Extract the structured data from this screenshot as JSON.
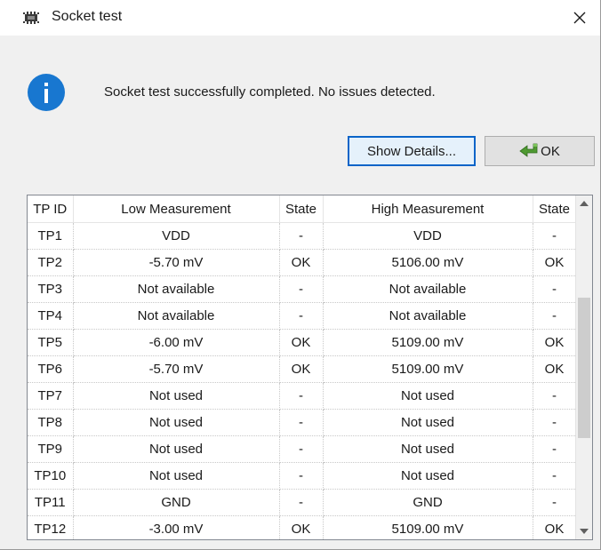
{
  "window": {
    "title": "Socket test",
    "icon": "chip-icon",
    "close_icon": "close-icon"
  },
  "message": {
    "icon": "info-icon",
    "text": "Socket test successfully completed. No issues detected."
  },
  "buttons": {
    "details": "Show Details...",
    "ok": "OK",
    "ok_icon": "green-arrow-icon"
  },
  "table": {
    "columns": [
      "TP ID",
      "Low Measurement",
      "State",
      "High Measurement",
      "State"
    ],
    "rows": [
      [
        "TP1",
        "VDD",
        "-",
        "VDD",
        "-"
      ],
      [
        "TP2",
        "-5.70 mV",
        "OK",
        "5106.00 mV",
        "OK"
      ],
      [
        "TP3",
        "Not available",
        "-",
        "Not available",
        "-"
      ],
      [
        "TP4",
        "Not available",
        "-",
        "Not available",
        "-"
      ],
      [
        "TP5",
        "-6.00 mV",
        "OK",
        "5109.00 mV",
        "OK"
      ],
      [
        "TP6",
        "-5.70 mV",
        "OK",
        "5109.00 mV",
        "OK"
      ],
      [
        "TP7",
        "Not used",
        "-",
        "Not used",
        "-"
      ],
      [
        "TP8",
        "Not used",
        "-",
        "Not used",
        "-"
      ],
      [
        "TP9",
        "Not used",
        "-",
        "Not used",
        "-"
      ],
      [
        "TP10",
        "Not used",
        "-",
        "Not used",
        "-"
      ],
      [
        "TP11",
        "GND",
        "-",
        "GND",
        "-"
      ],
      [
        "TP12",
        "-3.00 mV",
        "OK",
        "5109.00 mV",
        "OK"
      ]
    ]
  },
  "scrollbar": {
    "position_fraction": 0.5,
    "visible_fraction": 0.45
  },
  "colors": {
    "accent": "#1877d0",
    "focus_border": "#0a64c8",
    "ok_arrow": "#4f9a32"
  }
}
